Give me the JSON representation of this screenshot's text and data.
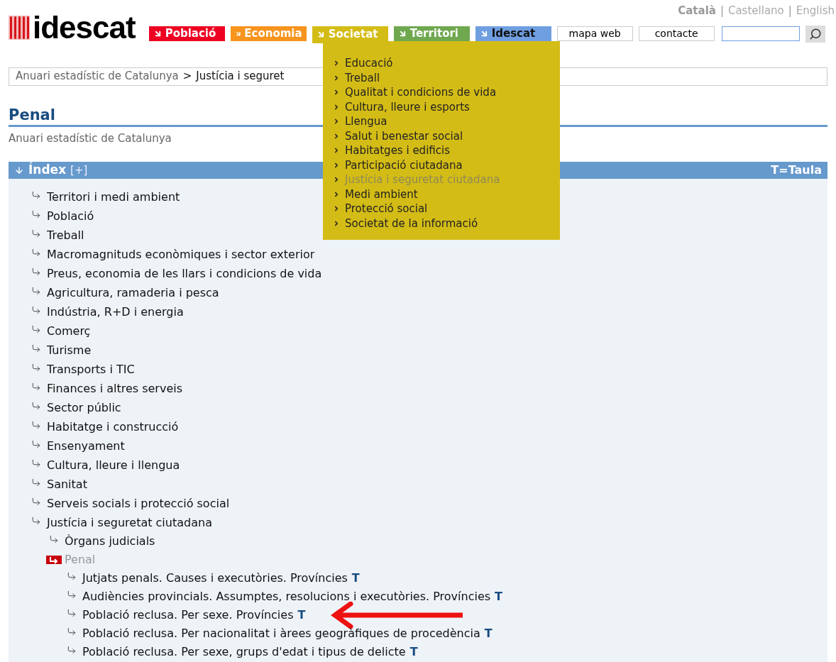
{
  "languages": [
    {
      "label": "Català",
      "selected": true
    },
    {
      "label": "Castellano",
      "selected": false
    },
    {
      "label": "English",
      "selected": false
    }
  ],
  "language_separator": "|",
  "logo": {
    "text": "idescat"
  },
  "nav_tabs": [
    {
      "label": "Població",
      "color": "#ee0022",
      "dark_text": false,
      "selected": false
    },
    {
      "label": "Economia",
      "color": "#f7941e",
      "dark_text": false,
      "selected": false
    },
    {
      "label": "Societat",
      "color": "#d4bc16",
      "dark_text": false,
      "selected": true
    },
    {
      "label": "Territori",
      "color": "#6fa84f",
      "dark_text": false,
      "selected": false
    },
    {
      "label": "Idescat",
      "color": "#6f9fe0",
      "dark_text": true,
      "selected": false
    }
  ],
  "utility_links": [
    "mapa web",
    "contacte"
  ],
  "search": {
    "kind": "text"
  },
  "dropdown": {
    "items": [
      {
        "label": "Educació",
        "selected": false
      },
      {
        "label": "Treball",
        "selected": false
      },
      {
        "label": "Qualitat i condicions de vida",
        "selected": false
      },
      {
        "label": "Cultura, lleure i esports",
        "selected": false
      },
      {
        "label": "Llengua",
        "selected": false
      },
      {
        "label": "Salut i benestar social",
        "selected": false
      },
      {
        "label": "Habitatges i edificis",
        "selected": false
      },
      {
        "label": "Participació ciutadana",
        "selected": false
      },
      {
        "label": "Justícia i seguretat ciutadana",
        "selected": true
      },
      {
        "label": "Medi ambient",
        "selected": false
      },
      {
        "label": "Protecció social",
        "selected": false
      },
      {
        "label": "Societat de la informació",
        "selected": false
      }
    ]
  },
  "breadcrumb": {
    "parent": "Anuari estadístic de Catalunya",
    "separator": ">",
    "current": "Justícia i seguret"
  },
  "page": {
    "title": "Penal",
    "subtitle": "Anuari estadístic de Catalunya"
  },
  "index": {
    "title": "Índex",
    "toggle": "[+]",
    "legend": "T=Taula",
    "items": [
      {
        "label": "Territori i medi ambient",
        "selected": false
      },
      {
        "label": "Població",
        "selected": false
      },
      {
        "label": "Treball",
        "selected": false
      },
      {
        "label": "Macromagnituds econòmiques i sector exterior",
        "selected": false
      },
      {
        "label": "Preus, economia de les llars i condicions de vida",
        "selected": false
      },
      {
        "label": "Agricultura, ramaderia i pesca",
        "selected": false
      },
      {
        "label": "Indústria, R+D i energia",
        "selected": false
      },
      {
        "label": "Comerç",
        "selected": false
      },
      {
        "label": "Turisme",
        "selected": false
      },
      {
        "label": "Transports i TIC",
        "selected": false
      },
      {
        "label": "Finances i altres serveis",
        "selected": false
      },
      {
        "label": "Sector públic",
        "selected": false
      },
      {
        "label": "Habitatge i construcció",
        "selected": false
      },
      {
        "label": "Ensenyament",
        "selected": false
      },
      {
        "label": "Cultura, lleure i llengua",
        "selected": false
      },
      {
        "label": "Sanitat",
        "selected": false
      },
      {
        "label": "Serveis socials i protecció social",
        "selected": false
      },
      {
        "label": "Justícia i seguretat ciutadana",
        "selected": false,
        "children": [
          {
            "label": "Òrgans judicials",
            "selected": false
          },
          {
            "label": "Penal",
            "selected": true,
            "children": [
              {
                "label": "Jutjats penals. Causes i executòries. Províncies",
                "table_link": "T",
                "arrow": false,
                "selected": false
              },
              {
                "label": "Audiències provincials. Assumptes, resolucions i executòries. Províncies",
                "table_link": "T",
                "arrow": false,
                "selected": false
              },
              {
                "label": "Població reclusa. Per sexe. Províncies",
                "table_link": "T",
                "arrow": true,
                "selected": false
              },
              {
                "label": "Població reclusa. Per nacionalitat i àrees geogràfiques de procedència",
                "table_link": "T",
                "arrow": false,
                "selected": false
              },
              {
                "label": "Població reclusa. Per sexe, grups d'edat i tipus de delicte",
                "table_link": "T",
                "arrow": false,
                "selected": false
              }
            ]
          }
        ]
      }
    ]
  }
}
